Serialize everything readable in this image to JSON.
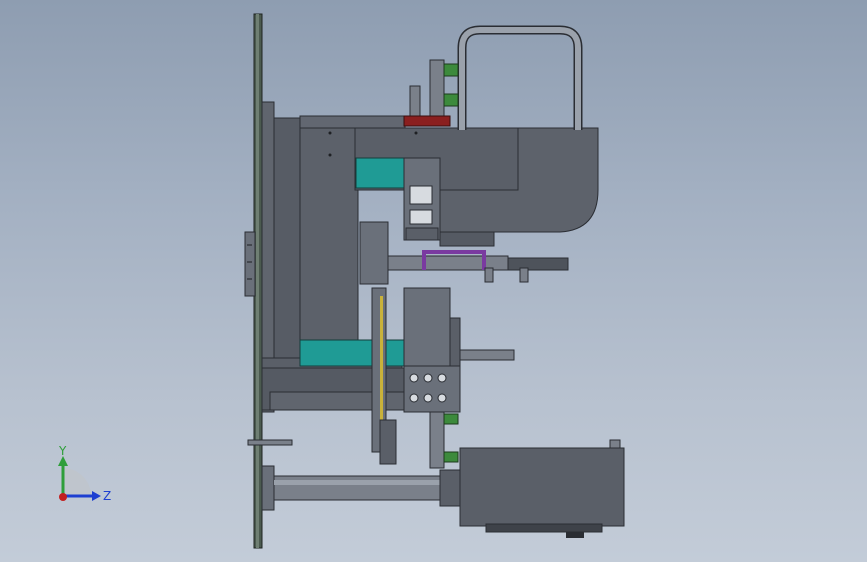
{
  "viewport": {
    "background_top": "#8e9db1",
    "background_bottom": "#c3ccd8"
  },
  "model": {
    "body_color": "#5a5f68",
    "edge_color": "#2a2d33",
    "teal_color": "#1f9b95",
    "green_fitting_color": "#3c8a3c",
    "red_part_color": "#8a1f1f",
    "purple_part_color": "#7a3aa0",
    "yellow_rod_color": "#c9b23a"
  },
  "triad": {
    "y_label": "Y",
    "z_label": "Z",
    "y_color": "#2e9e3a",
    "z_color": "#1d3fd1",
    "x_color": "#c21f1f"
  }
}
